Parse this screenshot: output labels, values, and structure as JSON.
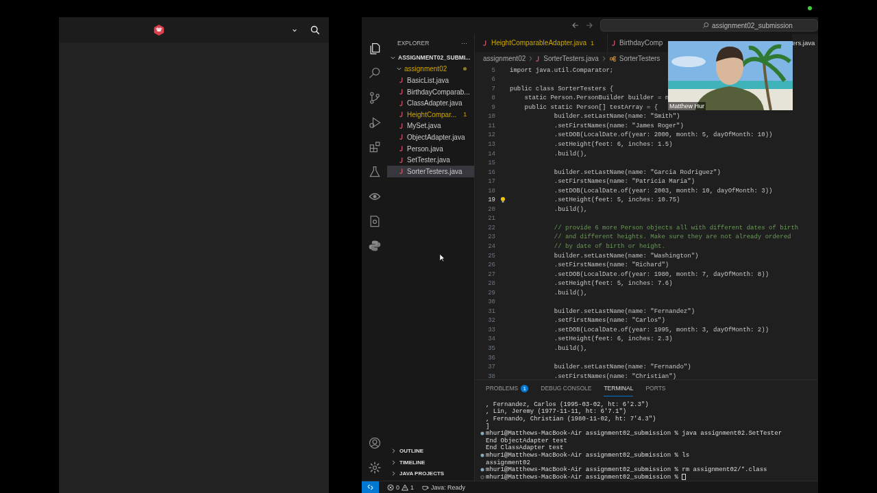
{
  "browser": {
    "expanded_menu": false
  },
  "vscode": {
    "search": "assignment02_submission",
    "explorer": {
      "title": "EXPLORER",
      "more": "···",
      "tree": [
        {
          "label": "ASSIGNMENT02_SUBMI...",
          "expanded": true,
          "children": [
            {
              "label": "assignment02",
              "expanded": true,
              "warning": true,
              "children": [
                {
                  "label": "BasicList.java",
                  "selected": false,
                  "warning": false
                },
                {
                  "label": "BirthdayComparab...",
                  "selected": false,
                  "warning": false
                },
                {
                  "label": "ClassAdapter.java",
                  "selected": false,
                  "warning": false
                },
                {
                  "label": "HeightCompar...",
                  "selected": false,
                  "warning": true,
                  "badge": "1"
                },
                {
                  "label": "MySet.java",
                  "selected": false,
                  "warning": false
                },
                {
                  "label": "ObjectAdapter.java",
                  "selected": false,
                  "warning": false
                },
                {
                  "label": "Person.java",
                  "selected": false,
                  "warning": false
                },
                {
                  "label": "SetTester.java",
                  "selected": false,
                  "warning": false
                },
                {
                  "label": "SorterTesters.java",
                  "selected": true,
                  "warning": false
                }
              ]
            }
          ]
        }
      ],
      "sections": [
        {
          "label": "OUTLINE",
          "expanded": false
        },
        {
          "label": "TIMELINE",
          "expanded": false
        },
        {
          "label": "JAVA PROJECTS",
          "expanded": false
        }
      ]
    },
    "tabs": [
      {
        "label": "HeightComparableAdapter.java",
        "badge": "1",
        "warning": true,
        "selected": false
      },
      {
        "label": "BirthdayComp",
        "warning": false,
        "selected": false
      },
      {
        "label": "ers.java",
        "warning": false,
        "selected": true
      }
    ],
    "breadcrumb": [
      "assignment02",
      "SorterTesters.java",
      "SorterTesters"
    ],
    "code": [
      {
        "n": "5",
        "text": "import java.util.Comparator;",
        "kind": "code",
        "current": false
      },
      {
        "n": "6",
        "current": false
      },
      {
        "n": "7",
        "text": "public class SorterTesters {",
        "kind": "code",
        "current": false
      },
      {
        "n": "8",
        "text": "    static Person.PersonBuilder builder = n",
        "kind": "code",
        "current": false
      },
      {
        "n": "9",
        "text": "    public static Person[] testArray = {",
        "kind": "code",
        "current": false
      },
      {
        "n": "10",
        "text": "            builder.setLastName(name: \"Smith\")",
        "kind": "code",
        "current": false
      },
      {
        "n": "11",
        "text": "            .setFirstNames(name: \"James Roger\")",
        "kind": "code",
        "current": false
      },
      {
        "n": "12",
        "text": "            .setDOB(LocalDate.of(year: 2000, month: 5, dayOfMonth: 10))",
        "kind": "code",
        "current": false
      },
      {
        "n": "13",
        "text": "            .setHeight(feet: 6, inches: 1.5)",
        "kind": "code",
        "current": false
      },
      {
        "n": "14",
        "text": "            .build(),",
        "kind": "code",
        "current": false
      },
      {
        "n": "15",
        "current": false
      },
      {
        "n": "16",
        "text": "            builder.setLastName(name: \"Garcia Rodriguez\")",
        "kind": "code",
        "current": false
      },
      {
        "n": "17",
        "text": "            .setFirstNames(name: \"Patricia Maria\")",
        "kind": "code",
        "current": false
      },
      {
        "n": "18",
        "text": "            .setDOB(LocalDate.of(year: 2003, month: 10, dayOfMonth: 3))",
        "kind": "code",
        "current": false
      },
      {
        "n": "19",
        "text": "            .setHeight(feet: 5, inches: 10.75)",
        "kind": "code",
        "current": true
      },
      {
        "n": "20",
        "text": "            .build(),",
        "kind": "code",
        "current": false
      },
      {
        "n": "21",
        "current": false
      },
      {
        "n": "22",
        "text": "            // provide 6 more Person objects all with different dates of birth",
        "kind": "comment",
        "current": false
      },
      {
        "n": "23",
        "text": "            // and different heights. Make sure they are not already ordered",
        "kind": "comment",
        "current": false
      },
      {
        "n": "24",
        "text": "            // by date of birth or height.",
        "kind": "comment",
        "current": false
      },
      {
        "n": "25",
        "text": "            builder.setLastName(name: \"Washington\")",
        "kind": "code",
        "current": false
      },
      {
        "n": "26",
        "text": "            .setFirstNames(name: \"Richard\")",
        "kind": "code",
        "current": false
      },
      {
        "n": "27",
        "text": "            .setDOB(LocalDate.of(year: 1980, month: 7, dayOfMonth: 8))",
        "kind": "code",
        "current": false
      },
      {
        "n": "28",
        "text": "            .setHeight(feet: 5, inches: 7.6)",
        "kind": "code",
        "current": false
      },
      {
        "n": "29",
        "text": "            .build(),",
        "kind": "code",
        "current": false
      },
      {
        "n": "30",
        "current": false
      },
      {
        "n": "31",
        "text": "            builder.setLastName(name: \"Fernandez\")",
        "kind": "code",
        "current": false
      },
      {
        "n": "32",
        "text": "            .setFirstNames(name: \"Carlos\")",
        "kind": "code",
        "current": false
      },
      {
        "n": "33",
        "text": "            .setDOB(LocalDate.of(year: 1995, month: 3, dayOfMonth: 2))",
        "kind": "code",
        "current": false
      },
      {
        "n": "34",
        "text": "            .setHeight(feet: 6, inches: 2.3)",
        "kind": "code",
        "current": false
      },
      {
        "n": "35",
        "text": "            .build(),",
        "kind": "code",
        "current": false
      },
      {
        "n": "36",
        "current": false
      },
      {
        "n": "37",
        "text": "            builder.setLastName(name: \"Fernando\")",
        "kind": "code",
        "current": false
      },
      {
        "n": "38",
        "text": "            .setFirstNames(name: \"Christian\")",
        "kind": "code",
        "current": false
      }
    ],
    "webcam": {
      "name": "Matthew Hur"
    },
    "panel_tabs": [
      {
        "label": "PROBLEMS",
        "badge": "1",
        "selected": false
      },
      {
        "label": "DEBUG CONSOLE",
        "selected": false
      },
      {
        "label": "TERMINAL",
        "selected": true
      },
      {
        "label": "PORTS",
        "selected": false
      }
    ],
    "terminal": [
      {
        "kind": "output",
        "text": ", Fernandez, Carlos (1995-03-02, ht: 6'2.3\")"
      },
      {
        "kind": "output",
        "text": ", Lin, Jeremy (1977-11-11, ht: 6'7.1\")"
      },
      {
        "kind": "output",
        "text": ", Fernando, Christian (1980-11-02, ht: 7'4.3\")"
      },
      {
        "kind": "output",
        "text": "]"
      },
      {
        "kind": "prompt",
        "text": "mhur1@Matthews-MacBook-Air assignment02_submission % java assignment02.SetTester"
      },
      {
        "kind": "output",
        "text": "End ObjectAdapter test"
      },
      {
        "kind": "output",
        "text": "End ClassAdapter test"
      },
      {
        "kind": "prompt",
        "text": "mhur1@Matthews-MacBook-Air assignment02_submission % ls"
      },
      {
        "kind": "output",
        "text": "assignment02"
      },
      {
        "kind": "prompt",
        "text": "mhur1@Matthews-MacBook-Air assignment02_submission % rm assignment02/*.class"
      },
      {
        "kind": "active",
        "text": "mhur1@Matthews-MacBook-Air assignment02_submission % "
      }
    ],
    "status": {
      "errors": "0",
      "warnings": "1",
      "java": "Java: Ready"
    }
  }
}
